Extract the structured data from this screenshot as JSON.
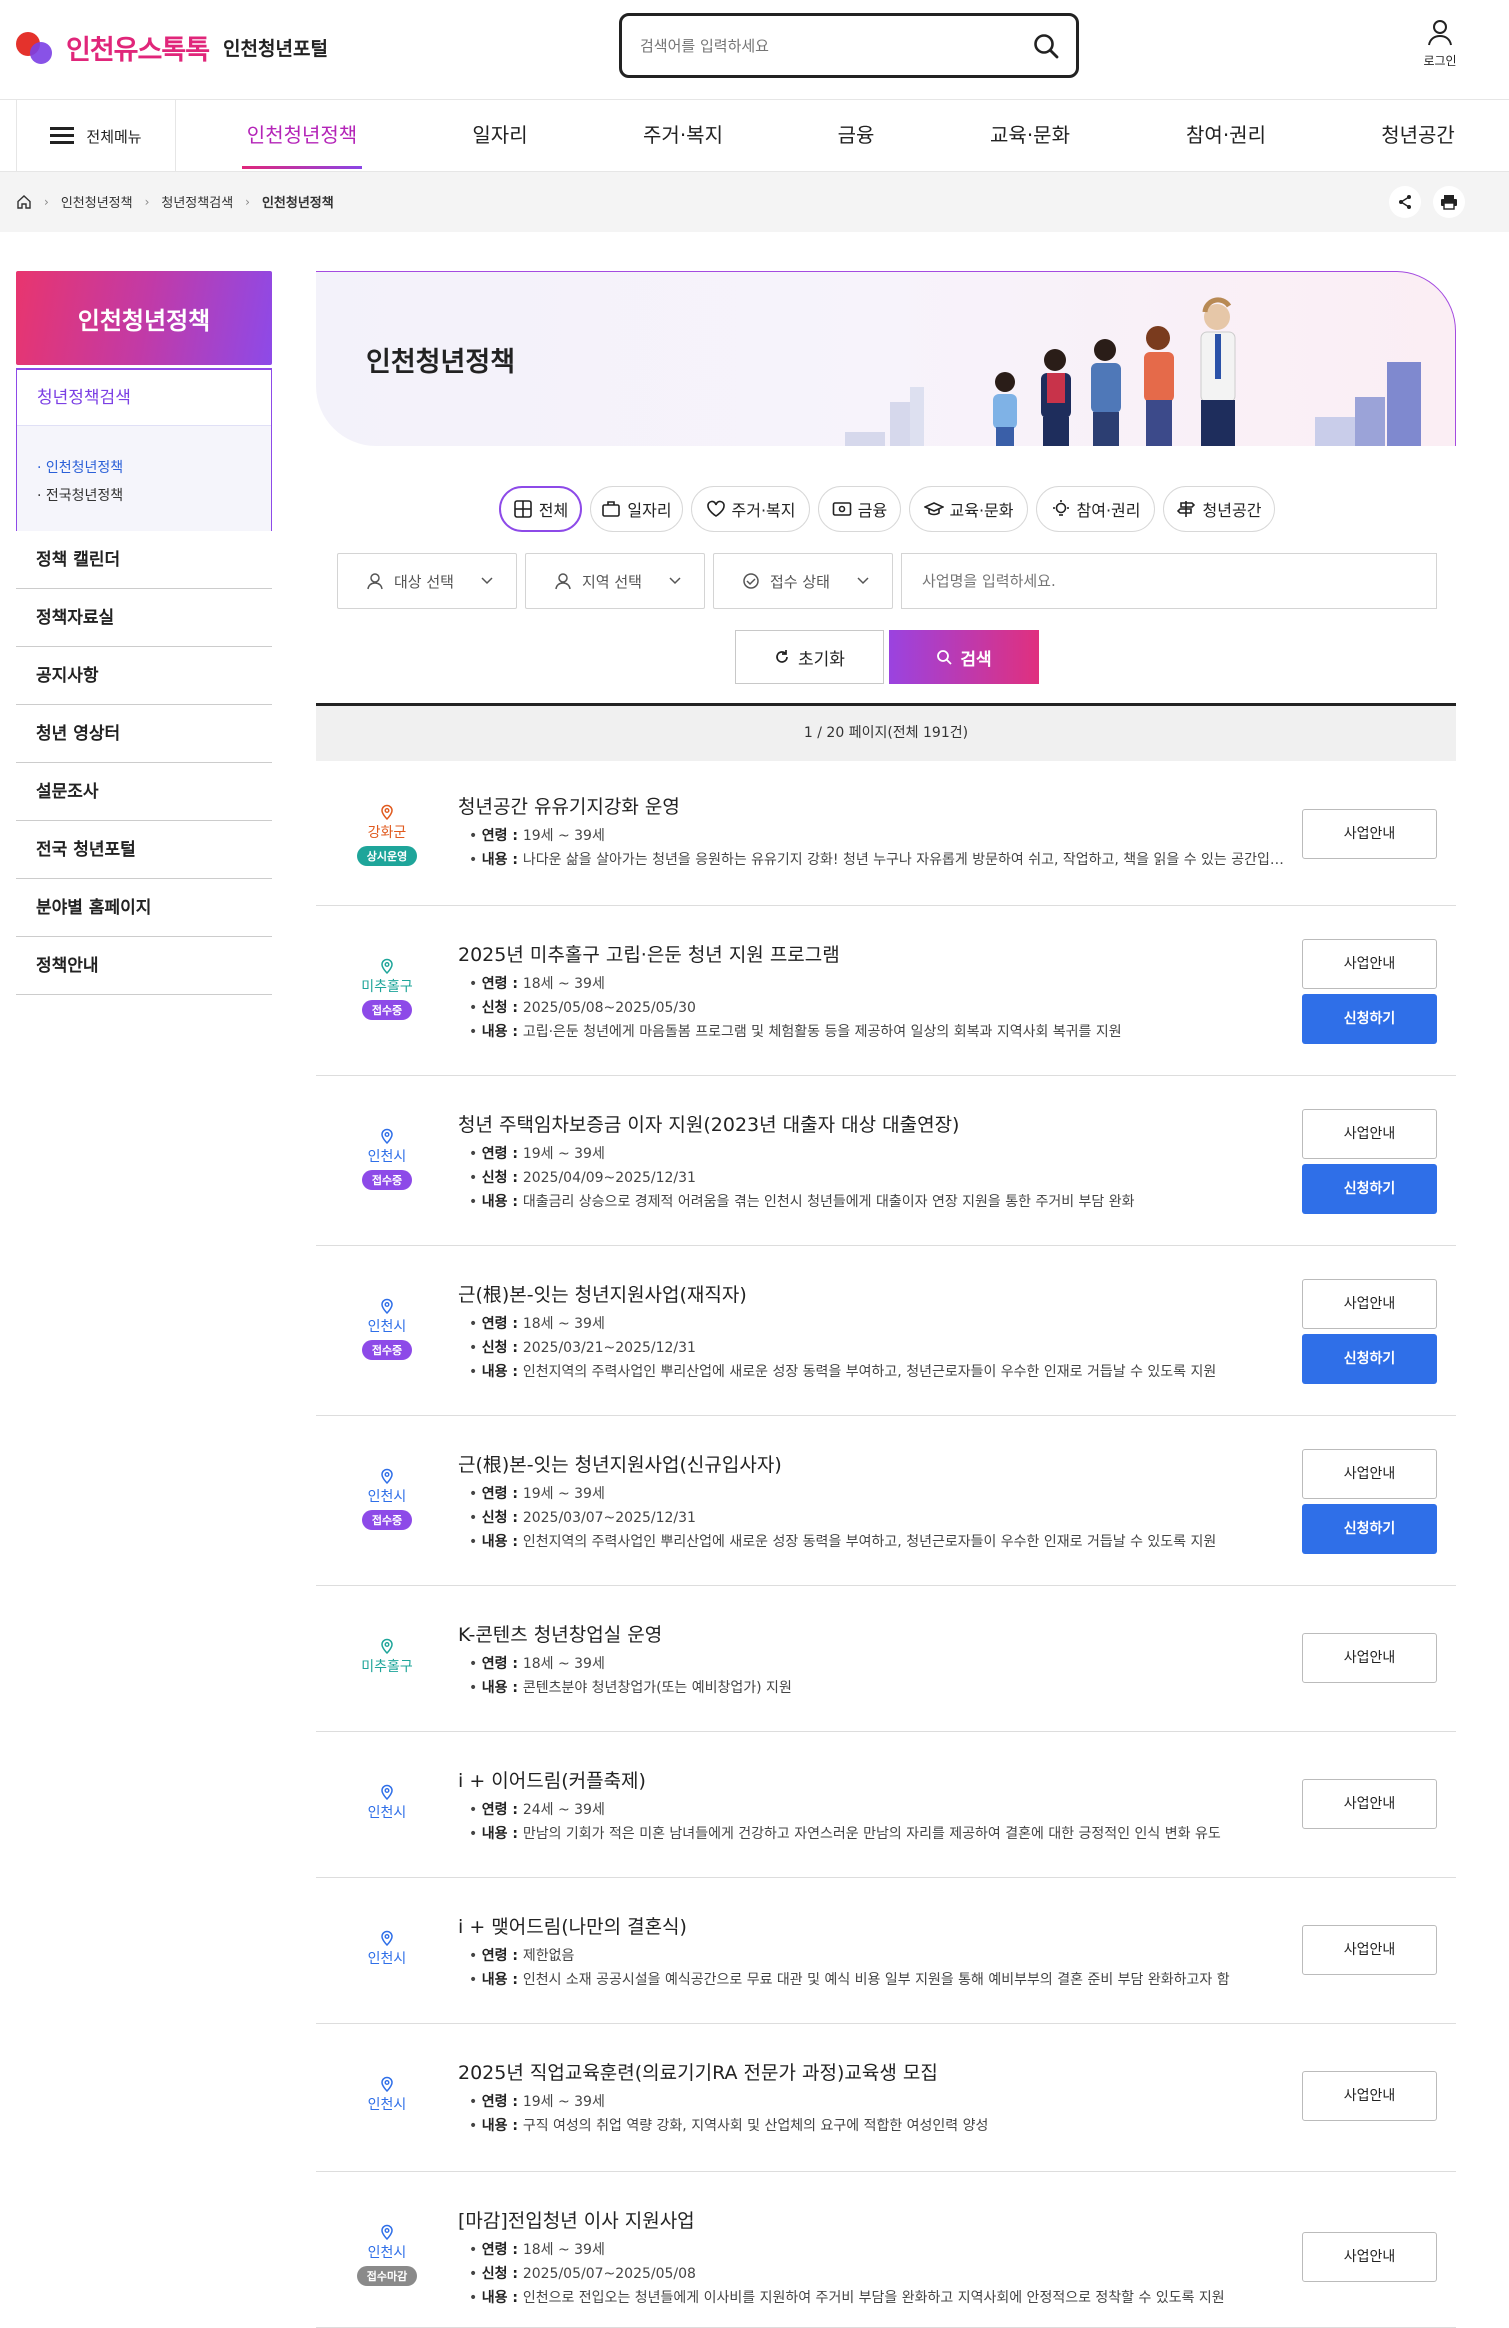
{
  "header": {
    "brand": "인천유스톡톡",
    "portal": "인천청년포털",
    "search_placeholder": "검색어를 입력하세요",
    "login": "로그인"
  },
  "gnb": {
    "all_menu": "전체메뉴",
    "items": [
      "인천청년정책",
      "일자리",
      "주거·복지",
      "금융",
      "교육·문화",
      "참여·권리",
      "청년공간"
    ]
  },
  "breadcrumb": [
    "인천청년정책",
    "청년정책검색",
    "인천청년정책"
  ],
  "sidebar": {
    "title": "인천청년정책",
    "section": "청년정책검색",
    "subs": [
      "인천청년정책",
      "전국청년정책"
    ],
    "items": [
      "정책 캘린더",
      "정책자료실",
      "공지사항",
      "청년 영상터",
      "설문조사",
      "전국 청년포털",
      "분야별 홈페이지",
      "정책안내"
    ]
  },
  "banner": {
    "title": "인천청년정책"
  },
  "categories": [
    "전체",
    "일자리",
    "주거·복지",
    "금융",
    "교육·문화",
    "참여·권리",
    "청년공간"
  ],
  "filters": {
    "target": "대상 선택",
    "region": "지역 선택",
    "status": "접수 상태",
    "keyword_placeholder": "사업명을 입력하세요.",
    "reset": "초기화",
    "search": "검색"
  },
  "results": {
    "count_text": "1 / 20 페이지(전체 191건)",
    "labels": {
      "age": "연령 : ",
      "apply": "신청 : ",
      "content": "내용 : ",
      "info_btn": "사업안내",
      "apply_btn": "신청하기"
    },
    "items": [
      {
        "region": "강화군",
        "badge": "상시운영",
        "title": "청년공간 유유기지강화 운영",
        "age": "19세 ~ 39세",
        "apply": "",
        "content": "나다운 삶을 살아가는 청년을 응원하는 유유기지 강화! 청년 누구나 자유롭게 방문하여 쉬고, 작업하고, 책을 읽을 수 있는 공간입니다."
      },
      {
        "region": "미추홀구",
        "badge": "접수중",
        "title": "2025년 미추홀구 고립·은둔 청년 지원 프로그램",
        "age": "18세 ~ 39세",
        "apply": "2025/05/08~2025/05/30",
        "content": "고립·은둔 청년에게 마음돌봄 프로그램 및 체험활동 등을 제공하여 일상의 회복과 지역사회 복귀를 지원"
      },
      {
        "region": "인천시",
        "badge": "접수중",
        "title": "청년 주택임차보증금 이자 지원(2023년 대출자 대상 대출연장)",
        "age": "19세 ~ 39세",
        "apply": "2025/04/09~2025/12/31",
        "content": "대출금리 상승으로 경제적 어려움을 겪는 인천시 청년들에게 대출이자 연장 지원을 통한 주거비 부담 완화"
      },
      {
        "region": "인천시",
        "badge": "접수중",
        "title": "근(根)본-잇는 청년지원사업(재직자)",
        "age": "18세 ~ 39세",
        "apply": "2025/03/21~2025/12/31",
        "content": "인천지역의 주력사업인 뿌리산업에 새로운 성장 동력을 부여하고, 청년근로자들이 우수한 인재로 거듭날 수 있도록 지원"
      },
      {
        "region": "인천시",
        "badge": "접수중",
        "title": "근(根)본-잇는 청년지원사업(신규입사자)",
        "age": "19세 ~ 39세",
        "apply": "2025/03/07~2025/12/31",
        "content": "인천지역의 주력사업인 뿌리산업에 새로운 성장 동력을 부여하고, 청년근로자들이 우수한 인재로 거듭날 수 있도록 지원"
      },
      {
        "region": "미추홀구",
        "badge": "",
        "title": "K-콘텐츠 청년창업실 운영",
        "age": "18세 ~ 39세",
        "apply": "",
        "content": "콘텐츠분야 청년창업가(또는 예비창업가) 지원"
      },
      {
        "region": "인천시",
        "badge": "",
        "title": "i + 이어드림(커플축제)",
        "age": "24세 ~ 39세",
        "apply": "",
        "content": "만남의 기회가 적은 미혼 남녀들에게 건강하고 자연스러운 만남의 자리를 제공하여 결혼에 대한 긍정적인 인식 변화 유도"
      },
      {
        "region": "인천시",
        "badge": "",
        "title": "i + 맺어드림(나만의 결혼식)",
        "age": "제한없음",
        "apply": "",
        "content": "인천시 소재 공공시설을 예식공간으로 무료 대관 및 예식 비용 일부 지원을 통해 예비부부의 결혼 준비 부담 완화하고자 함"
      },
      {
        "region": "인천시",
        "badge": "",
        "title": "2025년 직업교육훈련(의료기기RA 전문가 과정)교육생 모집",
        "age": "19세 ~ 39세",
        "apply": "",
        "content": "구직 여성의 취업 역량 강화, 지역사회 및 산업체의 요구에 적합한 여성인력 양성"
      },
      {
        "region": "인천시",
        "badge": "접수마감",
        "title": "[마감]전입청년 이사 지원사업",
        "age": "18세 ~ 39세",
        "apply": "2025/05/07~2025/05/08",
        "content": "인천으로 전입오는 청년들에게 이사비를 지원하여 주거비 부담을 완화하고 지역사회에 안정적으로 정착할 수 있도록 지원"
      }
    ]
  },
  "colors": {
    "accent_purple": "#8d4ae8",
    "accent_pink": "#e0267a",
    "apply_blue": "#2f6fe8",
    "badge_always": "#1ea59a",
    "badge_open": "#8d4ae8",
    "badge_closed": "#8a8a8a",
    "region_ganghwa": "#e05a1e",
    "region_michuhol": "#1ea59a",
    "region_incheon": "#2f6fe8"
  }
}
